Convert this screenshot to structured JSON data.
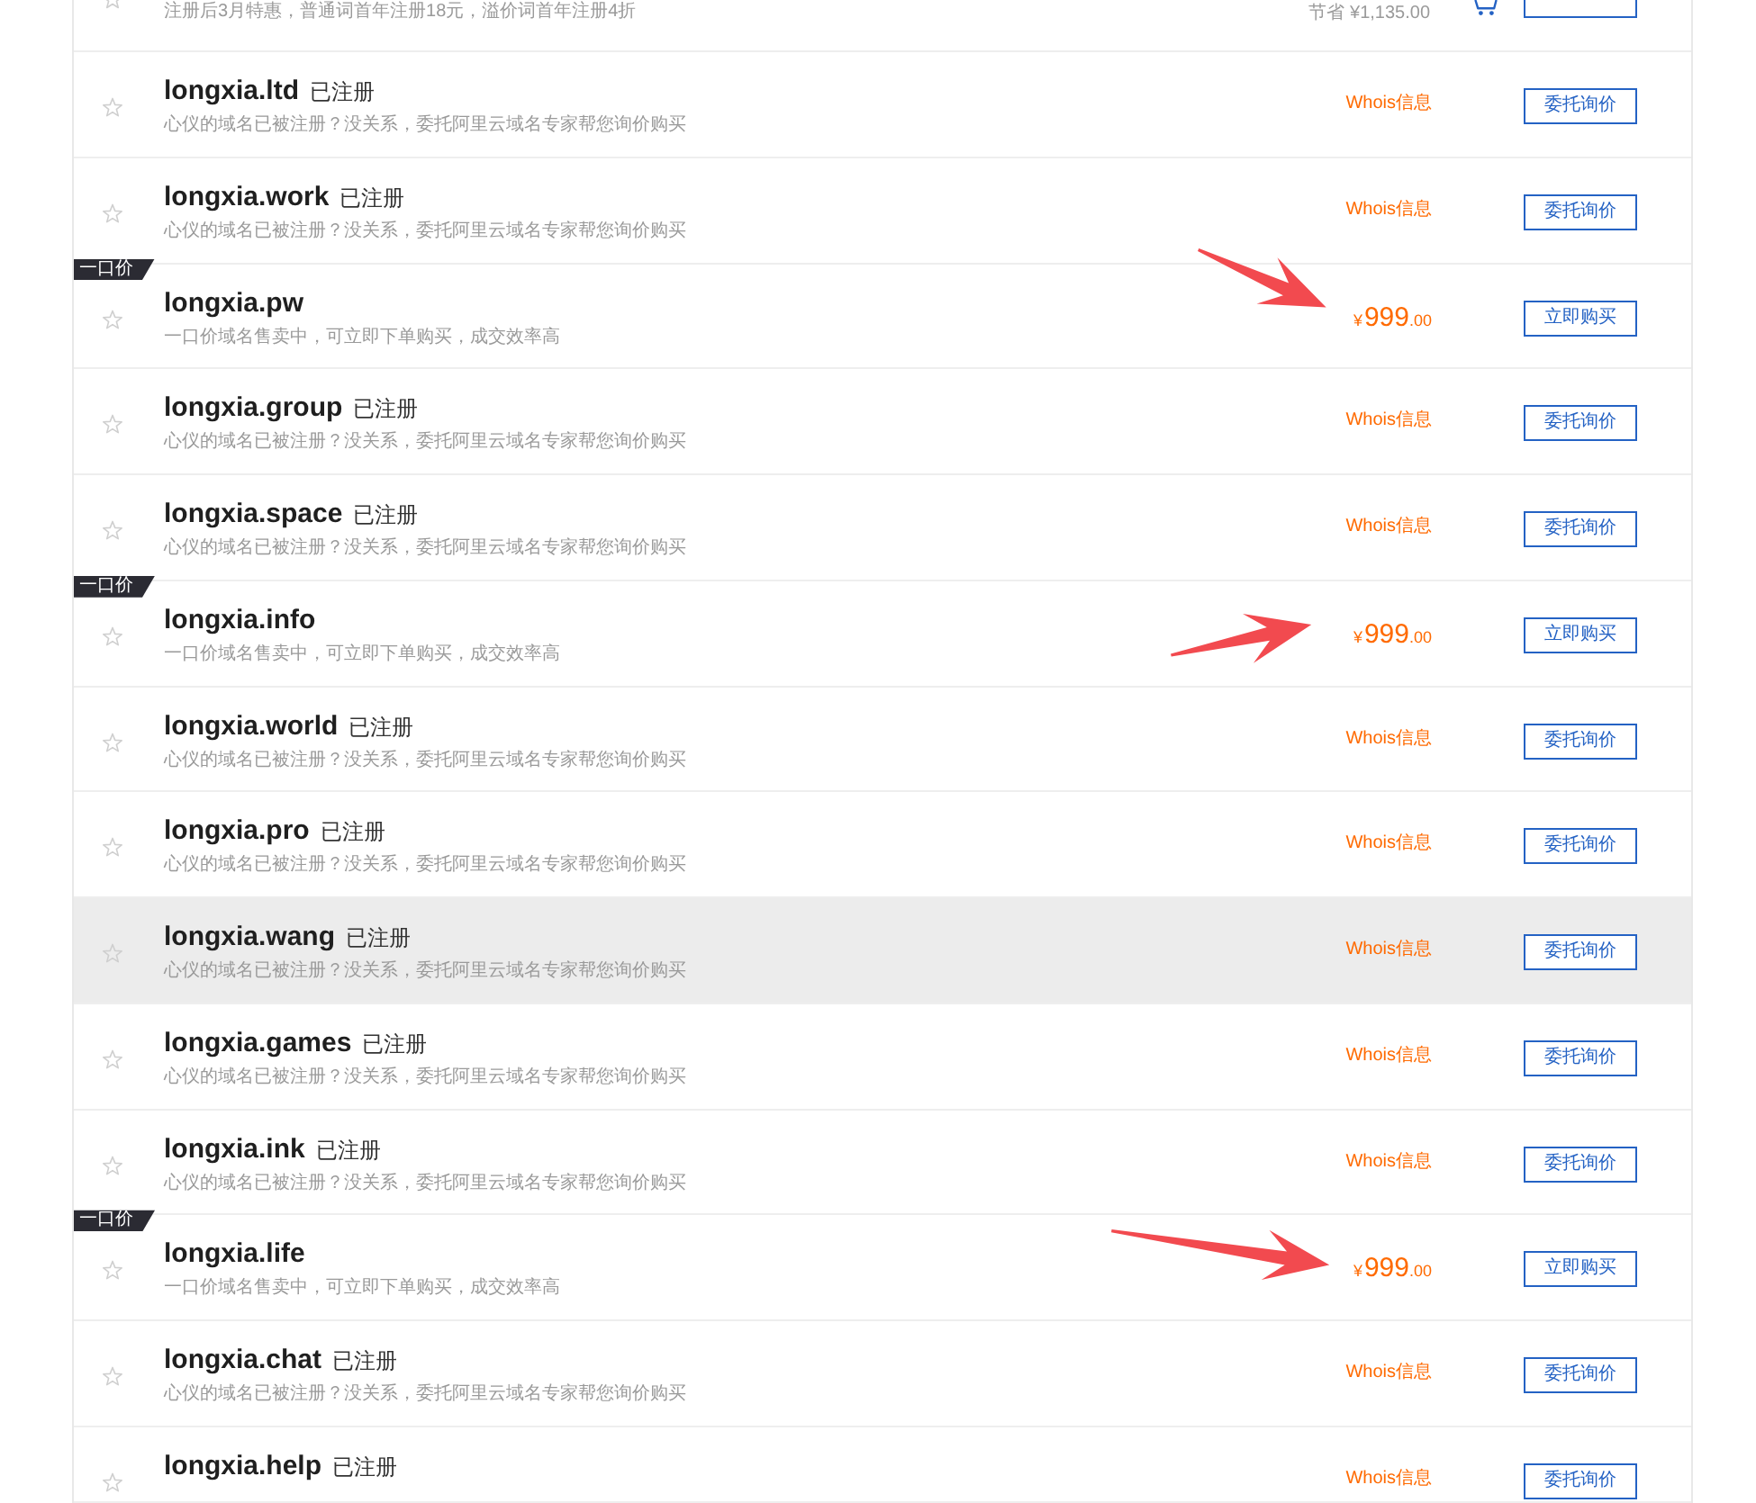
{
  "partial_row": {
    "description": "注册后3月特惠，普通词首年注册18元，溢价词首年注册4折",
    "savings": "节省 ¥1,135.00"
  },
  "domains": [
    {
      "kind": "registered",
      "name": "longxia.ltd",
      "status": "已注册",
      "description": "心仪的域名已被注册？没关系，委托阿里云域名专家帮您询价购买",
      "link": "Whois信息",
      "button": "委托询价",
      "highlighted": false
    },
    {
      "kind": "registered",
      "name": "longxia.work",
      "status": "已注册",
      "description": "心仪的域名已被注册？没关系，委托阿里云域名专家帮您询价购买",
      "link": "Whois信息",
      "button": "委托询价",
      "highlighted": false
    },
    {
      "kind": "fixed_price",
      "badge": "一口价",
      "name": "longxia.pw",
      "description": "一口价域名售卖中，可立即下单购买，成交效率高",
      "price": {
        "currency": "¥",
        "amount": "999",
        "cents": ".00"
      },
      "button": "立即购买",
      "arrow": {
        "kind": "from-upper-left"
      },
      "highlighted": false
    },
    {
      "kind": "registered",
      "name": "longxia.group",
      "status": "已注册",
      "description": "心仪的域名已被注册？没关系，委托阿里云域名专家帮您询价购买",
      "link": "Whois信息",
      "button": "委托询价",
      "highlighted": false
    },
    {
      "kind": "registered",
      "name": "longxia.space",
      "status": "已注册",
      "description": "心仪的域名已被注册？没关系，委托阿里云域名专家帮您询价购买",
      "link": "Whois信息",
      "button": "委托询价",
      "highlighted": false
    },
    {
      "kind": "fixed_price",
      "badge": "一口价",
      "name": "longxia.info",
      "description": "一口价域名售卖中，可立即下单购买，成交效率高",
      "price": {
        "currency": "¥",
        "amount": "999",
        "cents": ".00"
      },
      "button": "立即购买",
      "arrow": {
        "kind": "from-lower-left"
      },
      "highlighted": false
    },
    {
      "kind": "registered",
      "name": "longxia.world",
      "status": "已注册",
      "description": "心仪的域名已被注册？没关系，委托阿里云域名专家帮您询价购买",
      "link": "Whois信息",
      "button": "委托询价",
      "highlighted": false
    },
    {
      "kind": "registered",
      "name": "longxia.pro",
      "status": "已注册",
      "description": "心仪的域名已被注册？没关系，委托阿里云域名专家帮您询价购买",
      "link": "Whois信息",
      "button": "委托询价",
      "highlighted": false
    },
    {
      "kind": "registered",
      "name": "longxia.wang",
      "status": "已注册",
      "description": "心仪的域名已被注册？没关系，委托阿里云域名专家帮您询价购买",
      "link": "Whois信息",
      "button": "委托询价",
      "highlighted": true
    },
    {
      "kind": "registered",
      "name": "longxia.games",
      "status": "已注册",
      "description": "心仪的域名已被注册？没关系，委托阿里云域名专家帮您询价购买",
      "link": "Whois信息",
      "button": "委托询价",
      "highlighted": false
    },
    {
      "kind": "registered",
      "name": "longxia.ink",
      "status": "已注册",
      "description": "心仪的域名已被注册？没关系，委托阿里云域名专家帮您询价购买",
      "link": "Whois信息",
      "button": "委托询价",
      "highlighted": false
    },
    {
      "kind": "fixed_price",
      "badge": "一口价",
      "name": "longxia.life",
      "description": "一口价域名售卖中，可立即下单购买，成交效率高",
      "price": {
        "currency": "¥",
        "amount": "999",
        "cents": ".00"
      },
      "button": "立即购买",
      "arrow": {
        "kind": "from-left"
      },
      "highlighted": false
    },
    {
      "kind": "registered",
      "name": "longxia.chat",
      "status": "已注册",
      "description": "心仪的域名已被注册？没关系，委托阿里云域名专家帮您询价购买",
      "link": "Whois信息",
      "button": "委托询价",
      "highlighted": false
    },
    {
      "kind": "registered",
      "name": "longxia.help",
      "status": "已注册",
      "link": "Whois信息",
      "button": "委托询价",
      "highlighted": false
    }
  ]
}
